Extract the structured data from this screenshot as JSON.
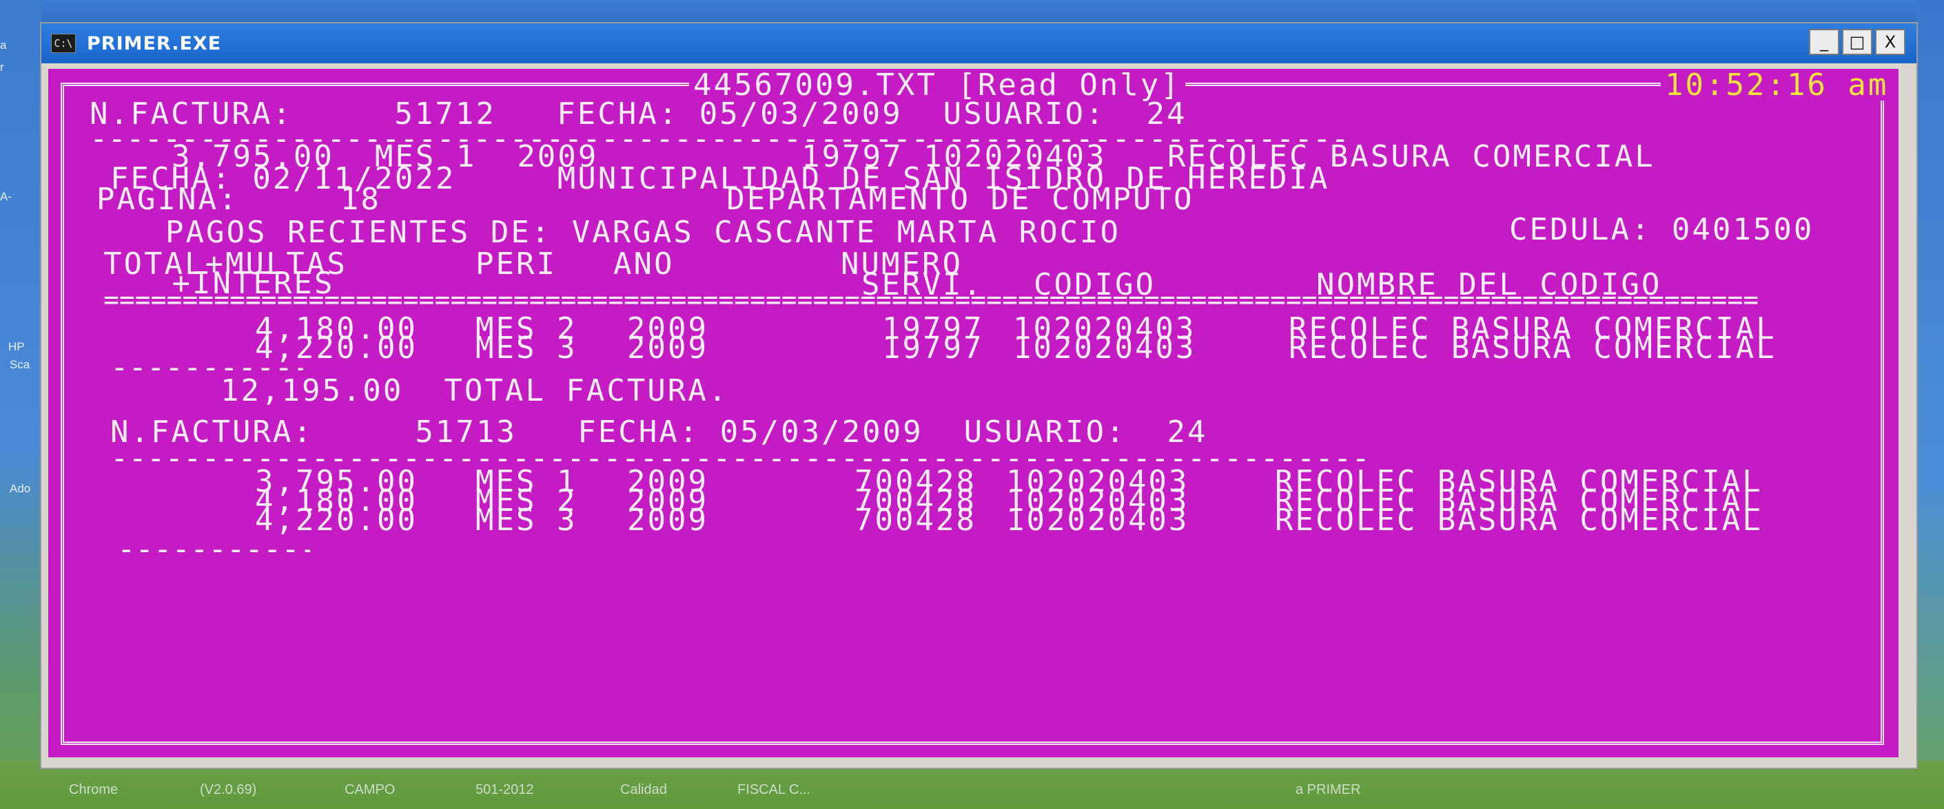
{
  "desktop": {
    "left_icons": [
      {
        "label": "a"
      },
      {
        "label": "r"
      },
      {
        "label": "A-"
      },
      {
        "label": "HP"
      },
      {
        "label": "Sca"
      },
      {
        "label": "Ado"
      }
    ],
    "taskbar_labels": [
      "Chrome",
      "(V2.0.69)",
      "CAMPO",
      "501-2012",
      "Calidad",
      "FISCAL C...",
      "a PRIMER"
    ]
  },
  "window": {
    "title": "PRIMER.EXE",
    "icon_text": "C:\\",
    "buttons": {
      "minimize": "_",
      "maximize": "□",
      "close": "X"
    }
  },
  "console": {
    "file_title": "44567009.TXT [Read Only]",
    "clock": "10:52:16 am",
    "invoice1": {
      "header": "N.FACTURA:     51712   FECHA: 05/03/2009  USUARIO:  24",
      "dash": "---------------------------------------------------------------------",
      "line1": "  3,795.00  MES 1  2009          19797 102020403   RECOLEC BASURA COMERCIAL",
      "line2": "FECHA: 02/11/2022     MUNICIPALIDAD DE SAN ISIDRO DE HEREDIA",
      "line3": "PAGINA:     18                 DEPARTAMENTO DE COMPUTO"
    },
    "person_line": "PAGOS RECIENTES DE: VARGAS CASCANTE MARTA ROCIO",
    "cedula": "CEDULA: 0401500",
    "columns": {
      "total_1": "TOTAL+MULTAS",
      "total_2": " +INTERES",
      "peri": "PERI",
      "ano": "ANO",
      "numero_1": "NUMERO",
      "numero_2": "SERVI.",
      "codigo": "CODIGO",
      "nombre": "NOMBRE DEL CODIGO"
    },
    "equals": "=========================================================================================================",
    "rows1": [
      {
        "total": "4,180.00",
        "peri": "MES 2",
        "ano": "2009",
        "servi": "19797",
        "codigo": "102020403",
        "nombre": "RECOLEC BASURA COMERCIAL"
      },
      {
        "total": "4,220.00",
        "peri": "MES 3",
        "ano": "2009",
        "servi": "19797",
        "codigo": "102020403",
        "nombre": "RECOLEC BASURA COMERCIAL"
      }
    ],
    "subtotal_dash": "-----------",
    "total_factura": "12,195.00  TOTAL FACTURA.",
    "invoice2": {
      "header": "N.FACTURA:     51713   FECHA: 05/03/2009  USUARIO:  24",
      "dash": "---------------------------------------------------------------------",
      "rows": [
        {
          "total": "3,795.00",
          "peri": "MES 1",
          "ano": "2009",
          "servi": "700428",
          "codigo": "102020403",
          "nombre": "RECOLEC BASURA COMERCIAL"
        },
        {
          "total": "4,180.00",
          "peri": "MES 2",
          "ano": "2009",
          "servi": "700428",
          "codigo": "102020403",
          "nombre": "RECOLEC BASURA COMERCIAL"
        },
        {
          "total": "4,220.00",
          "peri": "MES 3",
          "ano": "2009",
          "servi": "700428",
          "codigo": "102020403",
          "nombre": "RECOLEC BASURA COMERCIAL"
        }
      ],
      "end_dash": "-----------"
    }
  }
}
